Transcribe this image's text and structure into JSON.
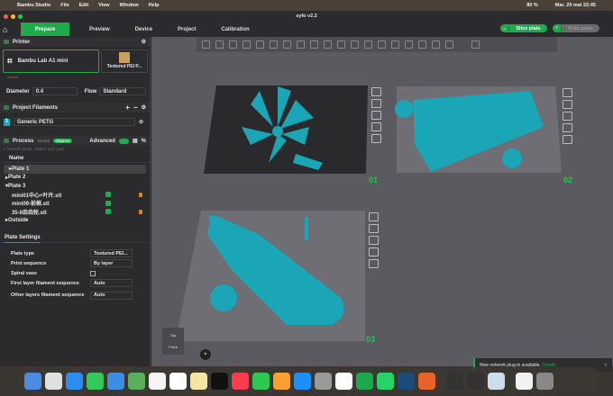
{
  "menubar": {
    "app": "Bambu Studio",
    "items": [
      "File",
      "Edit",
      "View",
      "Window",
      "Help"
    ],
    "battery": "80 %",
    "clock": "Mar. 20 mai  22:45"
  },
  "window": {
    "title": "syfo v2.2"
  },
  "tabs": [
    {
      "label": "Prepare"
    },
    {
      "label": "Preview"
    },
    {
      "label": "Device"
    },
    {
      "label": "Project"
    },
    {
      "label": "Calibration"
    }
  ],
  "actions": {
    "slice": "Slice plate",
    "print": "Print plate"
  },
  "printer": {
    "section": "Printer",
    "name": "Bambu Lab A1 mini",
    "plate_type": "Textured PEI P...",
    "nozzle_label": "Nozzle",
    "diameter_label": "Diameter",
    "diameter": "0.4",
    "flow_label": "Flow",
    "flow": "Standard"
  },
  "filaments": {
    "section": "Project Filaments",
    "items": [
      {
        "index": "1",
        "name": "Generic PETG",
        "color": "#1aa6b7"
      }
    ]
  },
  "process": {
    "section": "Process",
    "global": "Global",
    "objects": "Objects",
    "advanced": "Advanced",
    "search_placeholder": "Search plate, object and part.",
    "column_name": "Name"
  },
  "tree": [
    {
      "label": "Plate 1",
      "level": 0
    },
    {
      "label": "Plate 2",
      "level": 0
    },
    {
      "label": "Plate 3",
      "level": 0,
      "expanded": true
    },
    {
      "label": "mini01中心+叶片.stl",
      "level": 1,
      "lock": true
    },
    {
      "label": "mini09-前框.stl",
      "level": 1,
      "lock": false
    },
    {
      "label": "35-8齿齿轮.stl",
      "level": 1,
      "lock": true
    },
    {
      "label": "Outside",
      "level": 0
    }
  ],
  "plate_settings": {
    "tab": "Plate Settings",
    "rows": [
      {
        "label": "Plate type",
        "value": "Textured PEI..."
      },
      {
        "label": "Print sequence",
        "value": "By layer"
      },
      {
        "label": "Spiral vase",
        "value": ""
      },
      {
        "label": "First layer filament sequence",
        "value": "Auto"
      },
      {
        "label": "Other layers filament sequence",
        "value": "Auto"
      }
    ]
  },
  "plates": [
    "01",
    "02",
    "03"
  ],
  "viewcube": {
    "top": "Top",
    "front": "Front"
  },
  "toast": {
    "message": "New network plug-in available.",
    "link": "Details"
  },
  "colors": {
    "accent": "#1faa4c",
    "model": "#1aa6b7"
  }
}
